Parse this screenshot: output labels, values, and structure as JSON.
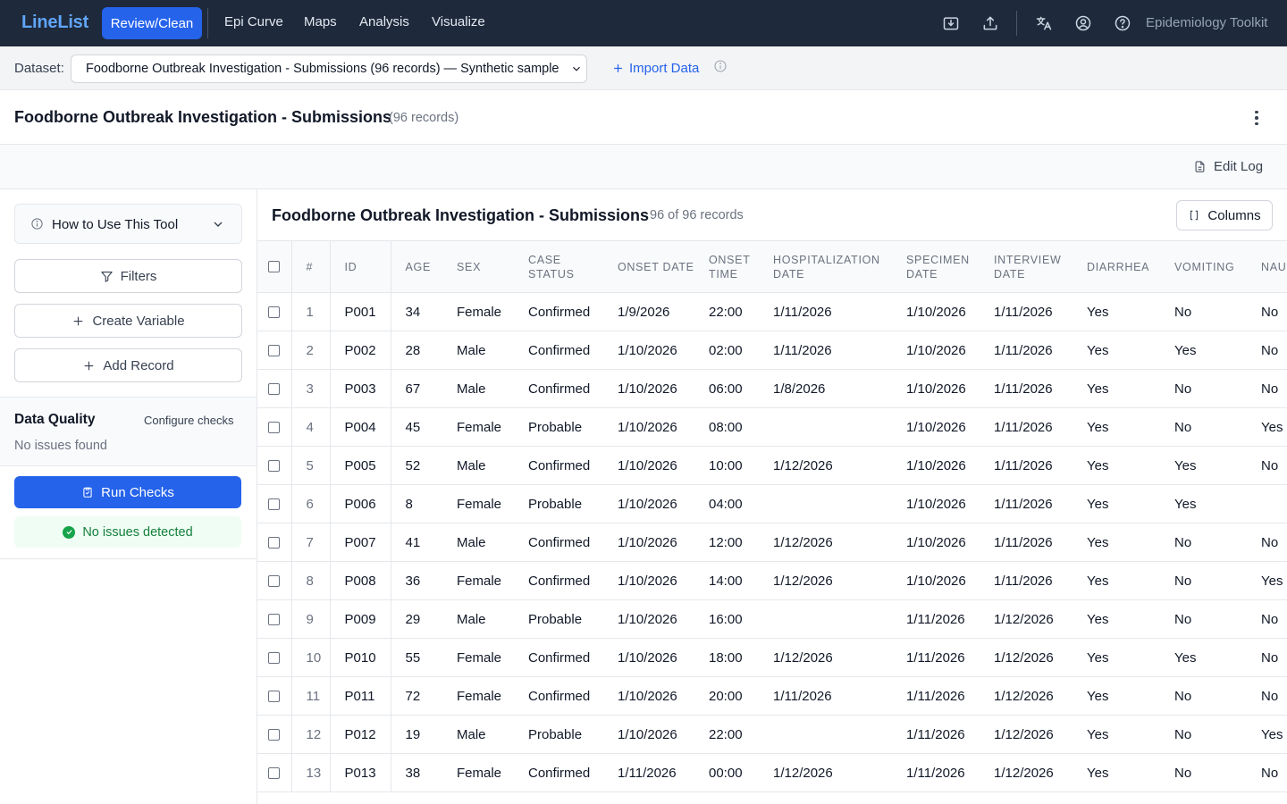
{
  "nav": {
    "brand": "LineList",
    "active_tab": "Review/Clean",
    "tabs": [
      "Epi Curve",
      "Maps",
      "Analysis",
      "Visualize"
    ],
    "toolkit_label": "Epidemiology Toolkit",
    "icons": [
      "download-icon",
      "upload-icon",
      "translate-icon",
      "account-icon",
      "help-icon"
    ]
  },
  "dataset": {
    "label": "Dataset:",
    "selected": "Foodborne Outbreak Investigation - Submissions (96 records) — Synthetic sample",
    "import_label": "Import Data"
  },
  "page": {
    "title": "Foodborne Outbreak Investigation - Submissions",
    "count": "(96 records)",
    "edit_log": "Edit Log"
  },
  "sidebar": {
    "howto": "How to Use This Tool",
    "filters": "Filters",
    "create_variable": "Create Variable",
    "add_record": "Add Record",
    "dq_title": "Data Quality",
    "dq_config": "Configure checks",
    "dq_status": "No issues found",
    "run_checks": "Run Checks",
    "ok_message": "No issues detected"
  },
  "table": {
    "title": "Foodborne Outbreak Investigation - Submissions",
    "count": "96 of 96 records",
    "columns_button": "Columns",
    "headers": [
      "#",
      "ID",
      "AGE",
      "SEX",
      "CASE STATUS",
      "ONSET DATE",
      "ONSET TIME",
      "HOSPITALIZATION DATE",
      "SPECIMEN DATE",
      "INTERVIEW DATE",
      "DIARRHEA",
      "VOMITING",
      "NAUS"
    ],
    "rows": [
      [
        "1",
        "P001",
        "34",
        "Female",
        "Confirmed",
        "1/9/2026",
        "22:00",
        "1/11/2026",
        "1/10/2026",
        "1/11/2026",
        "Yes",
        "No",
        "No"
      ],
      [
        "2",
        "P002",
        "28",
        "Male",
        "Confirmed",
        "1/10/2026",
        "02:00",
        "1/11/2026",
        "1/10/2026",
        "1/11/2026",
        "Yes",
        "Yes",
        "No"
      ],
      [
        "3",
        "P003",
        "67",
        "Male",
        "Confirmed",
        "1/10/2026",
        "06:00",
        "1/8/2026",
        "1/10/2026",
        "1/11/2026",
        "Yes",
        "No",
        "No"
      ],
      [
        "4",
        "P004",
        "45",
        "Female",
        "Probable",
        "1/10/2026",
        "08:00",
        "",
        "1/10/2026",
        "1/11/2026",
        "Yes",
        "No",
        "Yes"
      ],
      [
        "5",
        "P005",
        "52",
        "Male",
        "Confirmed",
        "1/10/2026",
        "10:00",
        "1/12/2026",
        "1/10/2026",
        "1/11/2026",
        "Yes",
        "Yes",
        "No"
      ],
      [
        "6",
        "P006",
        "8",
        "Female",
        "Probable",
        "1/10/2026",
        "04:00",
        "",
        "1/10/2026",
        "1/11/2026",
        "Yes",
        "Yes",
        ""
      ],
      [
        "7",
        "P007",
        "41",
        "Male",
        "Confirmed",
        "1/10/2026",
        "12:00",
        "1/12/2026",
        "1/10/2026",
        "1/11/2026",
        "Yes",
        "No",
        "No"
      ],
      [
        "8",
        "P008",
        "36",
        "Female",
        "Confirmed",
        "1/10/2026",
        "14:00",
        "1/12/2026",
        "1/10/2026",
        "1/11/2026",
        "Yes",
        "No",
        "Yes"
      ],
      [
        "9",
        "P009",
        "29",
        "Male",
        "Probable",
        "1/10/2026",
        "16:00",
        "",
        "1/11/2026",
        "1/12/2026",
        "Yes",
        "No",
        "No"
      ],
      [
        "10",
        "P010",
        "55",
        "Female",
        "Confirmed",
        "1/10/2026",
        "18:00",
        "1/12/2026",
        "1/11/2026",
        "1/12/2026",
        "Yes",
        "Yes",
        "No"
      ],
      [
        "11",
        "P011",
        "72",
        "Female",
        "Confirmed",
        "1/10/2026",
        "20:00",
        "1/11/2026",
        "1/11/2026",
        "1/12/2026",
        "Yes",
        "No",
        "No"
      ],
      [
        "12",
        "P012",
        "19",
        "Male",
        "Probable",
        "1/10/2026",
        "22:00",
        "",
        "1/11/2026",
        "1/12/2026",
        "Yes",
        "No",
        "Yes"
      ],
      [
        "13",
        "P013",
        "38",
        "Female",
        "Confirmed",
        "1/11/2026",
        "00:00",
        "1/12/2026",
        "1/11/2026",
        "1/12/2026",
        "Yes",
        "No",
        "No"
      ]
    ]
  },
  "colors": {
    "nav_bg": "#1e293b",
    "brand": "#60a5fa",
    "accent": "#2563eb",
    "success": "#16a34a"
  }
}
